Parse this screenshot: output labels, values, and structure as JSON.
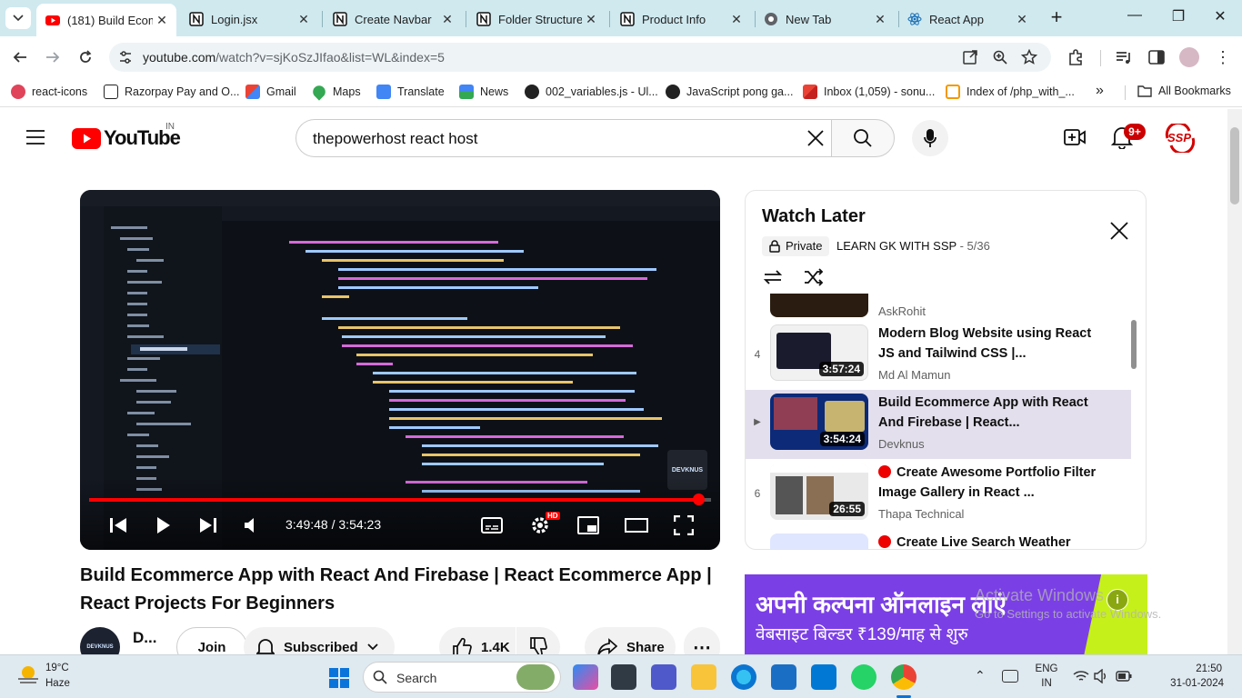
{
  "browser": {
    "tabs": [
      {
        "label": "(181) Build Ecom",
        "icon": "youtube-icon",
        "active": true
      },
      {
        "label": "Login.jsx",
        "icon": "notion-icon"
      },
      {
        "label": "Create Navbar",
        "icon": "notion-icon"
      },
      {
        "label": "Folder Structure",
        "icon": "notion-icon"
      },
      {
        "label": "Product Info",
        "icon": "notion-icon"
      },
      {
        "label": "New Tab",
        "icon": "chrome-icon"
      },
      {
        "label": "React App",
        "icon": "react-icon"
      }
    ],
    "new_tab_symbol": "+",
    "url_host": "youtube.com",
    "url_path": "/watch?v=sjKoSzJIfao&list=WL&index=5",
    "bookmarks": [
      {
        "label": "react-icons",
        "color": "#e0445a"
      },
      {
        "label": "Razorpay Pay and O...",
        "color": "#222222"
      },
      {
        "label": "Gmail",
        "color": "#ea4335"
      },
      {
        "label": "Maps",
        "color": "#34a853"
      },
      {
        "label": "Translate",
        "color": "#4285f4"
      },
      {
        "label": "News",
        "color": "#4285f4"
      },
      {
        "label": "002_variables.js - Ul...",
        "color": "#222222"
      },
      {
        "label": "JavaScript pong ga...",
        "color": "#222222"
      },
      {
        "label": "Inbox (1,059) - sonu...",
        "color": "#ea4335"
      },
      {
        "label": "Index of /php_with_...",
        "color": "#f29900"
      }
    ],
    "bookmarks_overflow": "»",
    "all_bookmarks": "All Bookmarks"
  },
  "youtube": {
    "logo_text": "YouTube",
    "region": "IN",
    "search_value": "thepowerhost react host",
    "notifications_count": "9+",
    "avatar_text": "SSP"
  },
  "player": {
    "time_current": "3:49:48",
    "time_total": "3:54:23",
    "time_separator": " / ",
    "progress": 0.98,
    "hd_badge": "HD",
    "watermark": "DEVKNUS"
  },
  "video": {
    "title": "Build Ecommerce App with React And Firebase | React Ecommerce App | React Projects For Beginners",
    "channel_short": "D...",
    "join_label": "Join",
    "subscribed_label": "Subscribed",
    "likes": "1.4K",
    "share_label": "Share"
  },
  "watch_later": {
    "title": "Watch Later",
    "privacy": "Private",
    "owner": "LEARN GK WITH SSP",
    "position": "5/36",
    "items": [
      {
        "index": "",
        "title": "",
        "channel": "AskRohit",
        "duration": "",
        "live": false,
        "current": false,
        "thumb": "#2a1c10"
      },
      {
        "index": "4",
        "title": "Modern Blog Website using React JS and Tailwind CSS |...",
        "channel": "Md Al Mamun",
        "duration": "3:57:24",
        "live": false,
        "current": false,
        "thumb": "#f1f1f1"
      },
      {
        "index": "▶",
        "title": "Build Ecommerce App with React And Firebase | React...",
        "channel": "Devknus",
        "duration": "3:54:24",
        "live": false,
        "current": true,
        "thumb": "#0c2a78"
      },
      {
        "index": "6",
        "title": "Create Awesome Portfolio Filter Image Gallery in React ...",
        "channel": "Thapa Technical",
        "duration": "26:55",
        "live": true,
        "current": false,
        "thumb": "#e9e9e9"
      },
      {
        "index": "",
        "title": "Create Live Search Weather",
        "channel": "",
        "duration": "",
        "live": true,
        "current": false,
        "thumb": "#dfe6ff"
      }
    ]
  },
  "ad": {
    "line1": "अपनी कल्पना ऑनलाइन लाएं",
    "line2": "वेबसाइट बिल्डर ₹139/माह से शुरु",
    "bg": "#7b3fe6",
    "accent": "#c6f01a"
  },
  "activation": {
    "line1": "Activate Windows",
    "line2": "Go to Settings to activate Windows."
  },
  "taskbar": {
    "weather_temp": "19°C",
    "weather_desc": "Haze",
    "search_label": "Search",
    "lang_line1": "ENG",
    "lang_line2": "IN",
    "time": "21:50",
    "date": "31-01-2024"
  }
}
